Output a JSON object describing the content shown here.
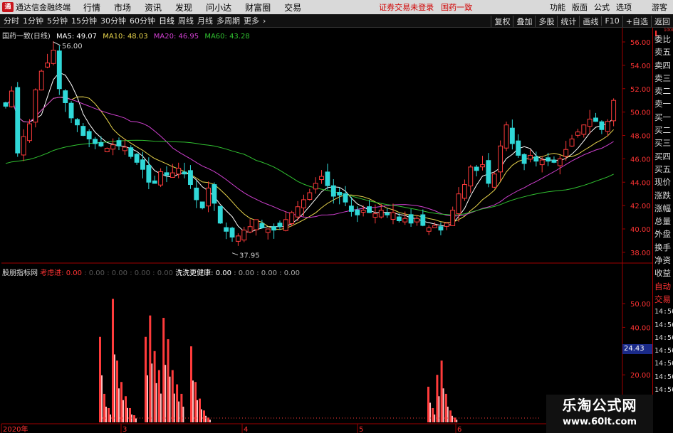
{
  "titlebar": {
    "logo_text": "通",
    "app_name": "通达信金融终端",
    "menu": [
      "行情",
      "市场",
      "资讯",
      "发现",
      "问小达",
      "财富圈",
      "交易"
    ],
    "notice": "证券交易未登录",
    "stock_name": "国药一致",
    "right": [
      "功能",
      "版面",
      "公式",
      "选项"
    ],
    "guest": "游客"
  },
  "periodbar": {
    "periods": [
      "分时",
      "1分钟",
      "5分钟",
      "15分钟",
      "30分钟",
      "60分钟",
      "日线",
      "周线",
      "月线",
      "多周期",
      "更多"
    ],
    "active": "日线",
    "more_arrow": "›",
    "right": [
      "复权",
      "叠加",
      "多股",
      "统计",
      "画线",
      "F10",
      "+自选",
      "返回"
    ]
  },
  "main_legend": {
    "title": "国药一致(日线)",
    "ma5": "MA5: 49.07",
    "ma10": "MA10: 48.03",
    "ma20": "MA20: 46.95",
    "ma60": "MA60: 43.28"
  },
  "sub_legend": {
    "name": "股朋指标网",
    "item1": "考虑进: 0.00",
    "values": ": 0.00 : 0.00 : 0.00 : 0.00",
    "item2": "洗洗更健康: 0.00",
    "values2": ": 0.00 : 0.00 : 0.00"
  },
  "chart_data": {
    "type": "candlestick",
    "y_main": {
      "min": 37.0,
      "max": 57.5,
      "ticks": [
        "56.00",
        "54.00",
        "52.00",
        "50.00",
        "48.00",
        "46.00",
        "44.00",
        "42.00",
        "40.00",
        "38.00"
      ]
    },
    "y_sub": {
      "min": 0,
      "max": 56,
      "ticks": [
        "50.00",
        "40.00",
        "30.00",
        "20.00"
      ]
    },
    "high_label": "56.00",
    "low_label": "37.95",
    "x_labels": [
      "2020年",
      "3",
      "4",
      "5",
      "6"
    ],
    "current_value": "24.43",
    "colors": {
      "up": "#ff3b3b",
      "down": "#30d8d8",
      "ma5": "#ffffff",
      "ma10": "#e8d44c",
      "ma20": "#d040d0",
      "ma60": "#30c030",
      "bar": "#ff3b3b",
      "bar_light": "#ffbbbb"
    },
    "closes": [
      50.5,
      51.8,
      46.5,
      47.9,
      49.0,
      51.9,
      53.5,
      54.2,
      55.3,
      52.0,
      50.8,
      49.5,
      48.9,
      48.0,
      47.7,
      47.3,
      47.1,
      46.9,
      47.2,
      47.1,
      47.0,
      46.2,
      45.7,
      45.1,
      44.0,
      43.9,
      44.9,
      44.6,
      44.8,
      45.2,
      44.7,
      43.8,
      42.5,
      41.8,
      43.5,
      42.2,
      40.5,
      39.8,
      39.3,
      39.4,
      39.9,
      40.2,
      40.8,
      40.1,
      40.0,
      39.9,
      40.2,
      40.8,
      41.4,
      41.9,
      42.5,
      43.1,
      43.9,
      44.5,
      43.7,
      42.8,
      42.9,
      42.3,
      41.5,
      41.2,
      41.6,
      41.4,
      41.3,
      41.6,
      41.2,
      41.4,
      40.7,
      40.9,
      40.5,
      40.9,
      40.3,
      40.1,
      40.3,
      39.9,
      40.5,
      41.6,
      43.0,
      43.8,
      45.3,
      45.0,
      45.5,
      43.9,
      44.7,
      47.1,
      48.9,
      47.3,
      46.3,
      45.6,
      46.3,
      45.8,
      45.9,
      45.8,
      45.7,
      46.0,
      46.8,
      47.7,
      48.3,
      48.9,
      49.4,
      49.2,
      48.5,
      49.2,
      51.0
    ],
    "sub_bars": [
      {
        "i": 12,
        "v": 36
      },
      {
        "i": 13,
        "v": 12
      },
      {
        "i": 14,
        "v": 6
      },
      {
        "i": 15,
        "v": 52
      },
      {
        "i": 16,
        "v": 26
      },
      {
        "i": 17,
        "v": 17
      },
      {
        "i": 18,
        "v": 11
      },
      {
        "i": 19,
        "v": 6
      },
      {
        "i": 20,
        "v": 3
      },
      {
        "i": 22,
        "v": 36
      },
      {
        "i": 23,
        "v": 45
      },
      {
        "i": 24,
        "v": 30
      },
      {
        "i": 25,
        "v": 22
      },
      {
        "i": 26,
        "v": 44
      },
      {
        "i": 27,
        "v": 35
      },
      {
        "i": 28,
        "v": 22
      },
      {
        "i": 29,
        "v": 16
      },
      {
        "i": 30,
        "v": 12
      },
      {
        "i": 31,
        "v": 32
      },
      {
        "i": 32,
        "v": 17
      },
      {
        "i": 33,
        "v": 10
      },
      {
        "i": 34,
        "v": 5
      },
      {
        "i": 35,
        "v": 2
      },
      {
        "i": 74,
        "v": 15
      },
      {
        "i": 75,
        "v": 6
      },
      {
        "i": 76,
        "v": 20
      },
      {
        "i": 77,
        "v": 26
      },
      {
        "i": 78,
        "v": 12
      },
      {
        "i": 79,
        "v": 5
      },
      {
        "i": 80,
        "v": 2
      }
    ]
  },
  "right_panel": {
    "top_label": "L",
    "top_dots": "1000",
    "items": [
      "委比",
      "卖五",
      "卖四",
      "卖三",
      "卖二",
      "卖一",
      "买一",
      "买二",
      "买三",
      "买四",
      "买五",
      "现价",
      "涨跌",
      "涨幅",
      "总量",
      "外盘",
      "换手",
      "净资",
      "收益",
      "自动",
      "交易",
      "14:56",
      "14:56",
      "14:56",
      "14:56",
      "14:56",
      "14:56",
      "14:56"
    ]
  },
  "watermark": {
    "title": "乐淘公式网",
    "url": "www.60lt.com"
  }
}
